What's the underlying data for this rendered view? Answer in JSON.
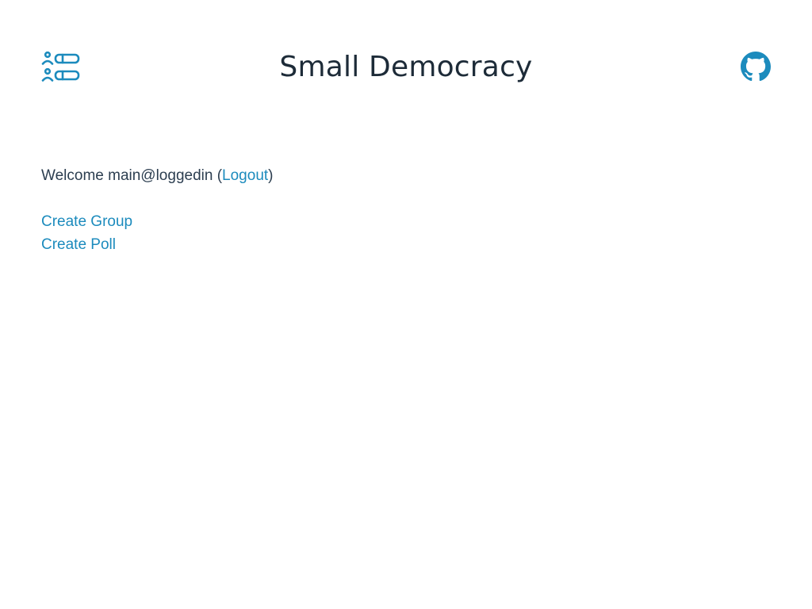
{
  "header": {
    "title": "Small Democracy",
    "logo_icon": "poll-list-icon",
    "github_icon": "github-icon",
    "accent_color": "#1c8bbd",
    "title_color": "#1d2b38"
  },
  "welcome": {
    "prefix": "Welcome main@loggedin (",
    "logout_label": "Logout",
    "suffix": ")"
  },
  "actions": {
    "create_group_label": "Create Group",
    "create_poll_label": "Create Poll"
  }
}
